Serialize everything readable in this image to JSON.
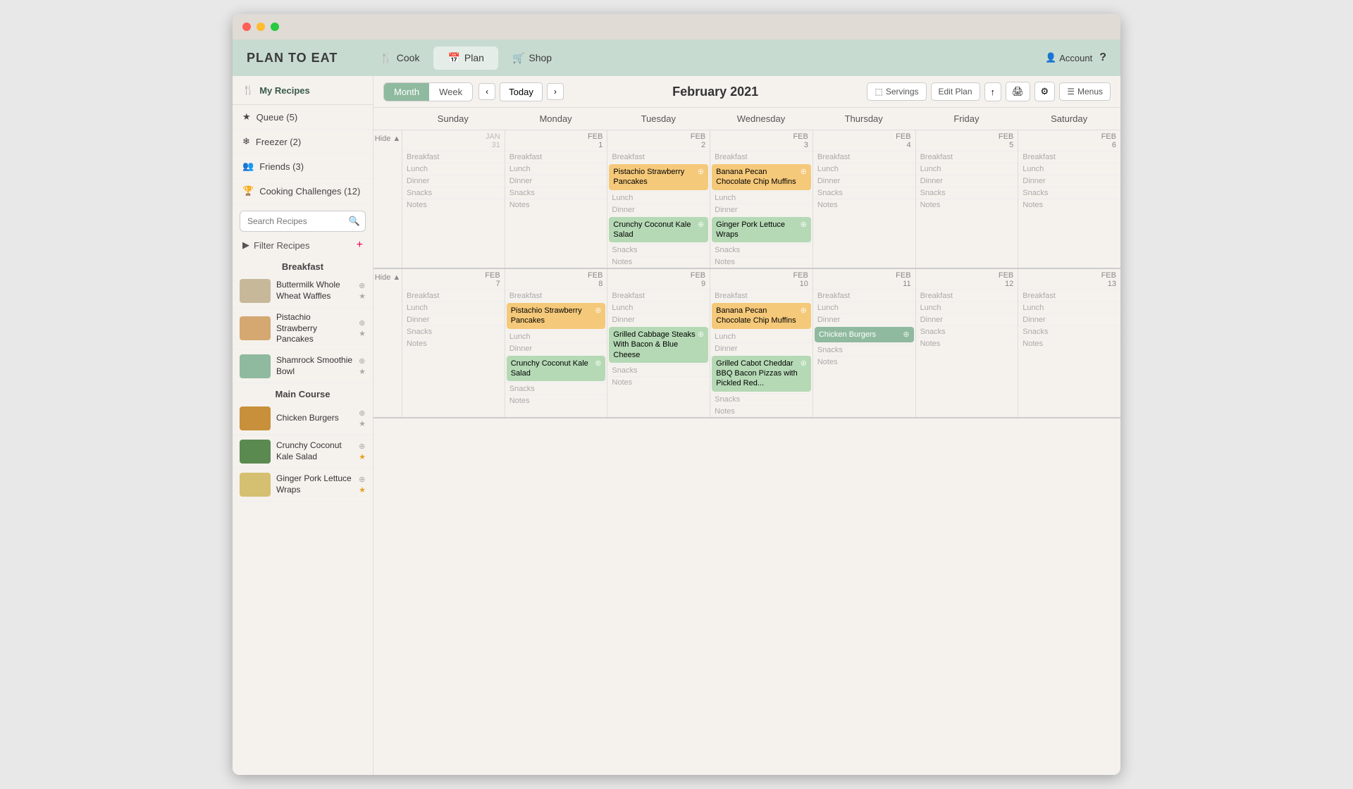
{
  "app": {
    "title": "PLAN TO EAT",
    "nav": {
      "cook": "Cook",
      "plan": "Plan",
      "shop": "Shop",
      "account": "Account"
    }
  },
  "sidebar": {
    "my_recipes": "My Recipes",
    "queue": "Queue (5)",
    "freezer": "Freezer (2)",
    "friends": "Friends (3)",
    "cooking_challenges": "Cooking Challenges (12)",
    "search_placeholder": "Search Recipes",
    "filter_recipes": "Filter Recipes",
    "sections": [
      {
        "title": "Breakfast",
        "items": [
          {
            "name": "Buttermilk Whole Wheat Waffles",
            "starred": false
          },
          {
            "name": "Pistachio Strawberry Pancakes",
            "starred": false
          },
          {
            "name": "Shamrock Smoothie Bowl",
            "starred": false
          }
        ]
      },
      {
        "title": "Main Course",
        "items": [
          {
            "name": "Chicken Burgers",
            "starred": false
          },
          {
            "name": "Crunchy Coconut Kale Salad",
            "starred": false
          },
          {
            "name": "Ginger Pork Lettuce Wraps",
            "starred": false
          }
        ]
      }
    ]
  },
  "calendar": {
    "view_month": "Month",
    "view_week": "Week",
    "today": "Today",
    "title": "February 2021",
    "tools": {
      "servings": "Servings",
      "edit_plan": "Edit Plan",
      "menus": "Menus"
    },
    "day_headers": [
      "Sunday",
      "Monday",
      "Tuesday",
      "Wednesday",
      "Thursday",
      "Friday",
      "Saturday"
    ],
    "weeks": [
      {
        "show_hide": "Hide",
        "days": [
          {
            "date_label": "JAN",
            "date_num": "31",
            "breakfast": [],
            "lunch": [],
            "dinner": [],
            "snacks": [],
            "notes": []
          },
          {
            "date_label": "FEB",
            "date_num": "1",
            "breakfast": [],
            "lunch": [],
            "dinner": [],
            "snacks": [],
            "notes": []
          },
          {
            "date_label": "FEB",
            "date_num": "2",
            "breakfast": [
              {
                "text": "Pistachio Strawberry Pancakes",
                "color": "orange"
              }
            ],
            "lunch": [],
            "dinner": [
              {
                "text": "Crunchy Coconut Kale Salad",
                "color": "green"
              }
            ],
            "snacks": [],
            "notes": []
          },
          {
            "date_label": "FEB",
            "date_num": "3",
            "breakfast": [
              {
                "text": "Banana Pecan Chocolate Chip Muffins",
                "color": "orange"
              }
            ],
            "lunch": [],
            "dinner": [
              {
                "text": "Ginger Pork Lettuce Wraps",
                "color": "green"
              }
            ],
            "snacks": [],
            "notes": []
          },
          {
            "date_label": "FEB",
            "date_num": "4",
            "breakfast": [],
            "lunch": [],
            "dinner": [],
            "snacks": [],
            "notes": []
          },
          {
            "date_label": "FEB",
            "date_num": "5",
            "breakfast": [],
            "lunch": [],
            "dinner": [],
            "snacks": [],
            "notes": []
          },
          {
            "date_label": "FEB",
            "date_num": "6",
            "breakfast": [],
            "lunch": [],
            "dinner": [],
            "snacks": [],
            "notes": []
          }
        ]
      },
      {
        "show_hide": "Hide",
        "days": [
          {
            "date_label": "FEB",
            "date_num": "7",
            "breakfast": [],
            "lunch": [],
            "dinner": [],
            "snacks": [],
            "notes": []
          },
          {
            "date_label": "FEB",
            "date_num": "8",
            "breakfast": [
              {
                "text": "Pistachio Strawberry Pancakes",
                "color": "orange"
              }
            ],
            "lunch": [],
            "dinner": [
              {
                "text": "Crunchy Coconut Kale Salad",
                "color": "green"
              }
            ],
            "snacks": [],
            "notes": []
          },
          {
            "date_label": "FEB",
            "date_num": "9",
            "breakfast": [],
            "lunch": [],
            "dinner": [
              {
                "text": "Grilled Cabbage Steaks With Bacon & Blue Cheese",
                "color": "green"
              }
            ],
            "snacks": [],
            "notes": []
          },
          {
            "date_label": "FEB",
            "date_num": "10",
            "breakfast": [
              {
                "text": "Banana Pecan Chocolate Chip Muffins",
                "color": "orange"
              }
            ],
            "lunch": [],
            "dinner": [
              {
                "text": "Grilled Cabot Cheddar BBQ Bacon Pizzas with Pickled Red...",
                "color": "green"
              }
            ],
            "snacks": [],
            "notes": []
          },
          {
            "date_label": "FEB",
            "date_num": "11",
            "breakfast": [],
            "lunch": [],
            "dinner": [
              {
                "text": "Chicken Burgers",
                "color": "teal"
              }
            ],
            "snacks": [],
            "notes": []
          },
          {
            "date_label": "FEB",
            "date_num": "12",
            "breakfast": [],
            "lunch": [],
            "dinner": [],
            "snacks": [],
            "notes": []
          },
          {
            "date_label": "FEB",
            "date_num": "13",
            "breakfast": [],
            "lunch": [],
            "dinner": [],
            "snacks": [],
            "notes": []
          }
        ]
      }
    ]
  }
}
